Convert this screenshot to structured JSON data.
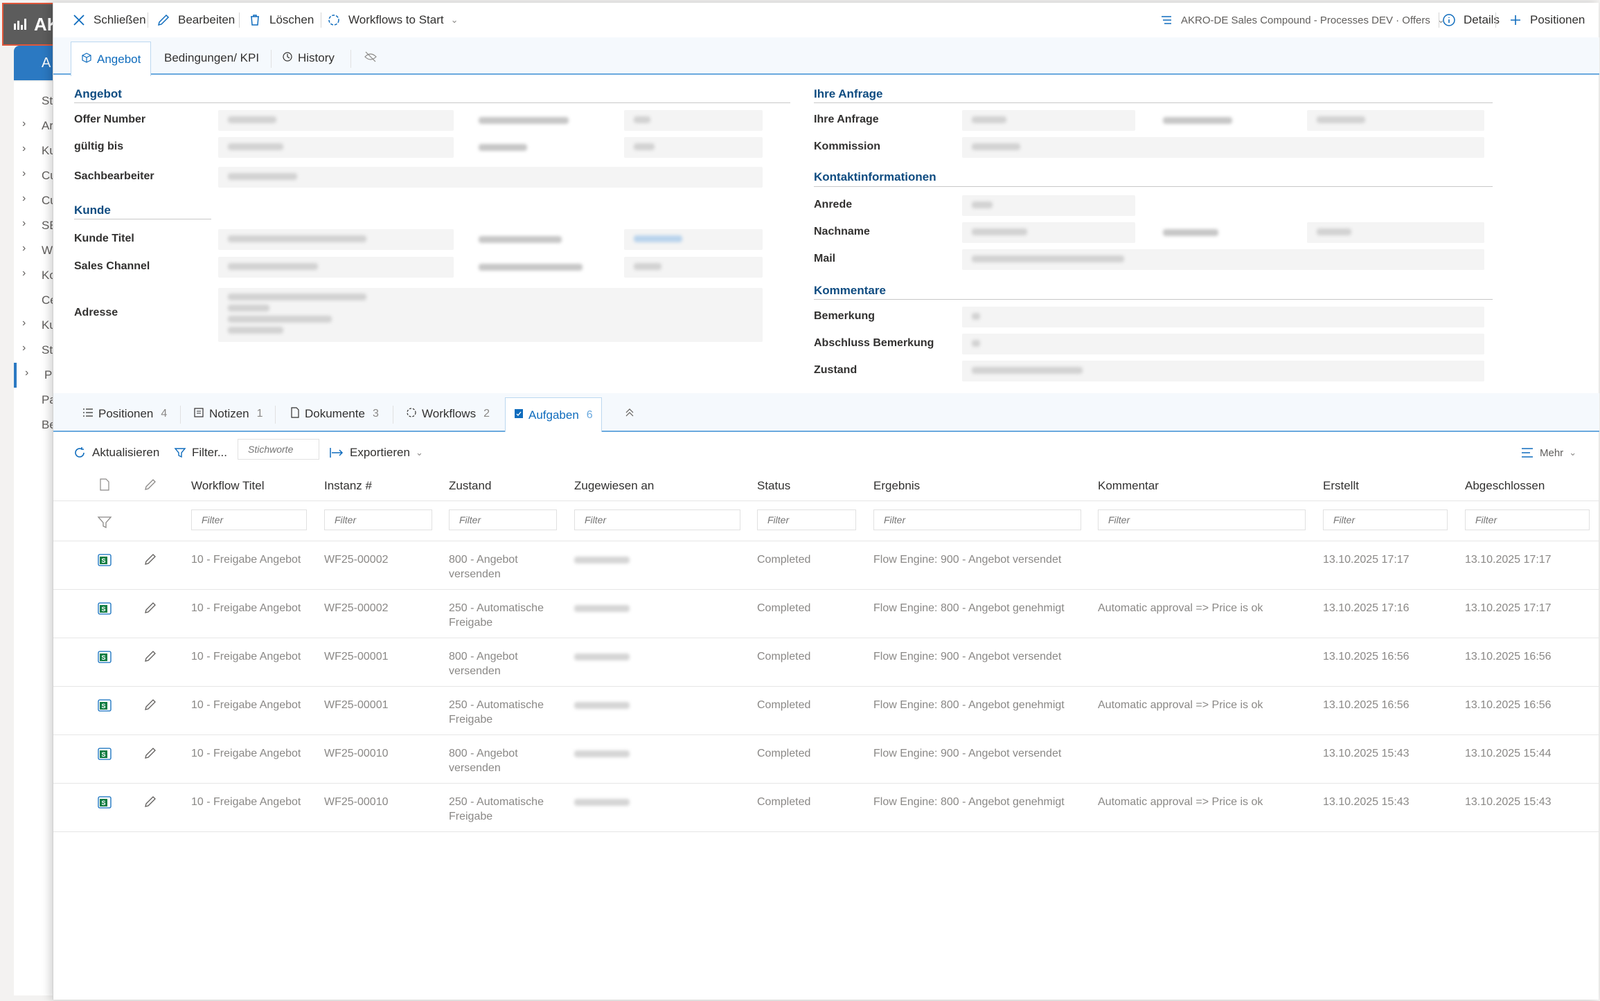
{
  "background_app": {
    "brand": "AK",
    "side_tab": "A",
    "side_items": [
      "St",
      "Ar",
      "Ku",
      "Cu",
      "Cu",
      "SE",
      "W",
      "Ko",
      "Ce",
      "Ku",
      "St",
      "Pr",
      "Pa",
      "Be"
    ]
  },
  "toolbar": {
    "close": "Schließen",
    "edit": "Bearbeiten",
    "delete": "Löschen",
    "workflows_to_start": "Workflows to Start",
    "breadcrumb": "AKRO-DE Sales Compound - Processes DEV · Offers",
    "details": "Details",
    "positions": "Positionen"
  },
  "top_tabs": [
    "Angebot",
    "Bedingungen/ KPI",
    "History"
  ],
  "form": {
    "angebot": {
      "title": "Angebot",
      "labels": [
        "Offer Number",
        "gültig bis",
        "Sachbearbeiter"
      ]
    },
    "kunde": {
      "title": "Kunde",
      "labels": [
        "Kunde Titel",
        "Sales Channel",
        "Adresse"
      ]
    },
    "ihre_anfrage": {
      "title": "Ihre Anfrage",
      "labels": [
        "Ihre Anfrage",
        "Kommission"
      ]
    },
    "kontakt": {
      "title": "Kontaktinformationen",
      "labels": [
        "Anrede",
        "Nachname",
        "Mail"
      ]
    },
    "kommentare": {
      "title": "Kommentare",
      "labels": [
        "Bemerkung",
        "Abschluss Bemerkung",
        "Zustand"
      ]
    }
  },
  "lower_tabs": [
    {
      "label": "Positionen",
      "count": "4"
    },
    {
      "label": "Notizen",
      "count": "1"
    },
    {
      "label": "Dokumente",
      "count": "3"
    },
    {
      "label": "Workflows",
      "count": "2"
    },
    {
      "label": "Aufgaben",
      "count": "6"
    }
  ],
  "grid_toolbar": {
    "refresh": "Aktualisieren",
    "filter": "Filter...",
    "keywords_placeholder": "Stichworte",
    "export": "Exportieren",
    "more": "Mehr"
  },
  "grid": {
    "headers": [
      "Workflow Titel",
      "Instanz #",
      "Zustand",
      "Zugewiesen an",
      "Status",
      "Ergebnis",
      "Kommentar",
      "Erstellt",
      "Abgeschlossen"
    ],
    "filter_placeholder": "Filter",
    "rows": [
      {
        "title": "10 - Freigabe Angebot",
        "instance": "WF25-00002",
        "state": "800 - Angebot versenden",
        "status": "Completed",
        "result": "Flow Engine: 900 - Angebot versendet",
        "comment": "",
        "created": "13.10.2025 17:17",
        "closed": "13.10.2025 17:17"
      },
      {
        "title": "10 - Freigabe Angebot",
        "instance": "WF25-00002",
        "state": "250 - Automatische Freigabe",
        "status": "Completed",
        "result": "Flow Engine: 800 - Angebot genehmigt",
        "comment": "Automatic approval => Price is ok",
        "created": "13.10.2025 17:16",
        "closed": "13.10.2025 17:17"
      },
      {
        "title": "10 - Freigabe Angebot",
        "instance": "WF25-00001",
        "state": "800 - Angebot versenden",
        "status": "Completed",
        "result": "Flow Engine: 900 - Angebot versendet",
        "comment": "",
        "created": "13.10.2025 16:56",
        "closed": "13.10.2025 16:56"
      },
      {
        "title": "10 - Freigabe Angebot",
        "instance": "WF25-00001",
        "state": "250 - Automatische Freigabe",
        "status": "Completed",
        "result": "Flow Engine: 800 - Angebot genehmigt",
        "comment": "Automatic approval => Price is ok",
        "created": "13.10.2025 16:56",
        "closed": "13.10.2025 16:56"
      },
      {
        "title": "10 - Freigabe Angebot",
        "instance": "WF25-00010",
        "state": "800 - Angebot versenden",
        "status": "Completed",
        "result": "Flow Engine: 900 - Angebot versendet",
        "comment": "",
        "created": "13.10.2025 15:43",
        "closed": "13.10.2025 15:44"
      },
      {
        "title": "10 - Freigabe Angebot",
        "instance": "WF25-00010",
        "state": "250 - Automatische Freigabe",
        "status": "Completed",
        "result": "Flow Engine: 800 - Angebot genehmigt",
        "comment": "Automatic approval => Price is ok",
        "created": "13.10.2025 15:43",
        "closed": "13.10.2025 15:43"
      }
    ]
  },
  "colors": {
    "accent": "#0f6cbd",
    "section_title": "#0f4c81",
    "tab_bar": "#f5f9fd"
  }
}
